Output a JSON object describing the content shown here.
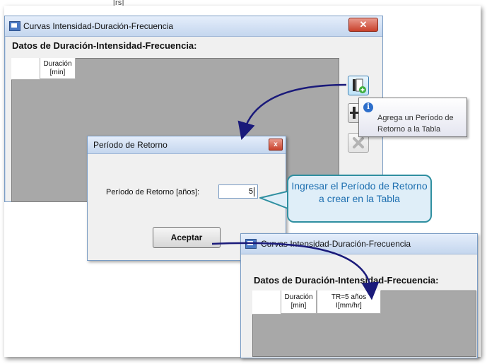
{
  "top_crop": "[rs]",
  "main_window": {
    "title": "Curvas Intensidad-Duración-Frecuencia",
    "close_label": "✕",
    "section_title": "Datos de Duración-Intensidad-Frecuencia:",
    "grid": {
      "col1_line1": "Duración",
      "col1_line2": "[min]"
    }
  },
  "tooltip": {
    "icon": "i",
    "text": "Agrega un Período de Retorno a la Tabla"
  },
  "dialog": {
    "title": "Período de Retorno",
    "close_label": "x",
    "field_label": "Período de Retorno [años]:",
    "field_value": "5",
    "ok_label": "Aceptar"
  },
  "callout": {
    "text": "Ingresar el Período de Retorno a crear en la Tabla"
  },
  "second_window": {
    "title": "Curvas Intensidad-Duración-Frecuencia",
    "section_title": "Datos de Duración-Intensidad-Frecuencia:",
    "grid": {
      "col1_line1": "Duración",
      "col1_line2": "[min]",
      "col2_line1": "TR=5 años",
      "col2_line2": "I[mm/hr]"
    }
  },
  "colors": {
    "arrow": "#1a1a7a",
    "callout_text": "#1d6fb0",
    "callout_border": "#2f8fa0"
  }
}
